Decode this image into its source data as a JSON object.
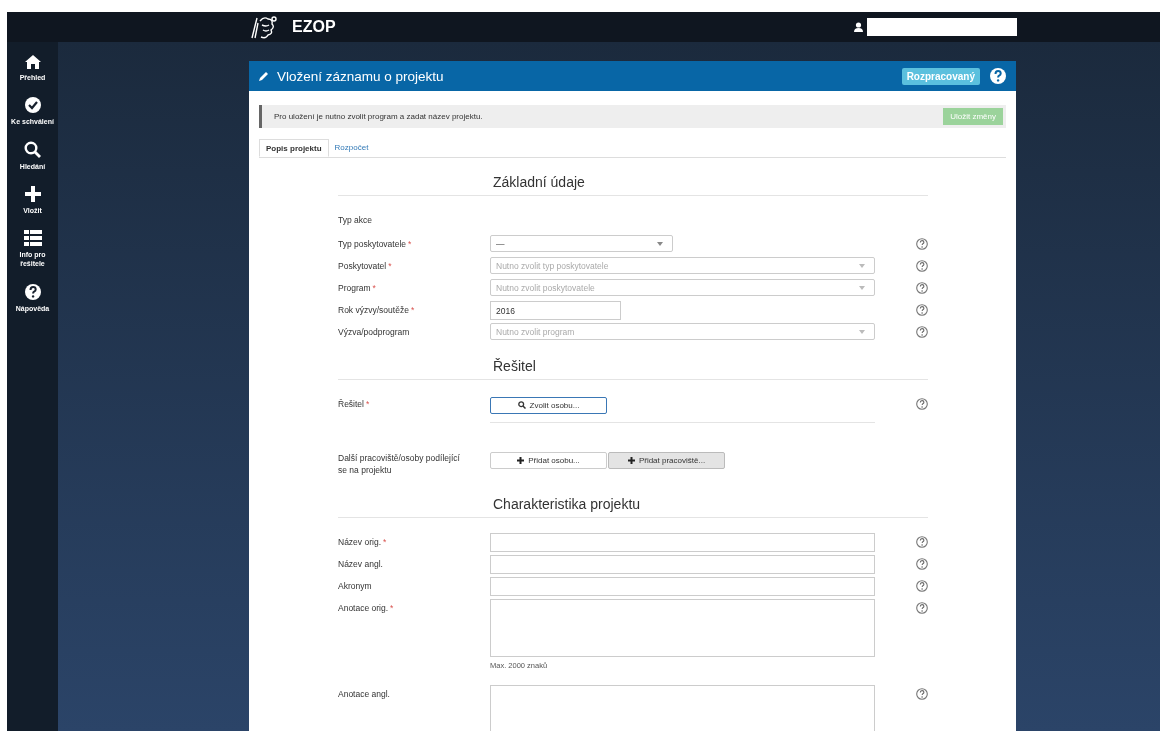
{
  "top_bar": {
    "app_name": "EZOP"
  },
  "sidebar": {
    "items": [
      {
        "label": "Přehled"
      },
      {
        "label": "Ke schválení"
      },
      {
        "label": "Hledání"
      },
      {
        "label": "Vložit"
      },
      {
        "label": "Info pro řešitele"
      },
      {
        "label": "Nápověda"
      }
    ]
  },
  "panel": {
    "title": "Vložení záznamu o projektu",
    "status": "Rozpracovaný",
    "alert": {
      "text": "Pro uložení je nutno zvolit program a zadat název projektu.",
      "save_button": {
        "label": "Uložit změny",
        "disabled": true
      }
    },
    "tabs": [
      {
        "label": "Popis projektu",
        "selected": true
      },
      {
        "label": "Rozpočet",
        "selected": false
      }
    ],
    "sections": [
      {
        "heading": "Základní údaje",
        "fields": [
          {
            "kind": "text",
            "label": "Typ akce"
          },
          {
            "kind": "select",
            "label": "Typ poskytovatele",
            "mark": "*",
            "value": "—",
            "disabled": false,
            "help": true
          },
          {
            "kind": "select",
            "label": "Poskytovatel",
            "mark": "*",
            "placeholder": "Nutno zvolit typ poskytovatele",
            "disabled": true,
            "help": true
          },
          {
            "kind": "select",
            "label": "Program",
            "mark": "*",
            "placeholder": "Nutno zvolit poskytovatele",
            "disabled": true,
            "help": true
          },
          {
            "kind": "input",
            "label": "Rok výzvy/soutěže",
            "mark": "*",
            "value": "2016",
            "help": true
          },
          {
            "kind": "select",
            "label": "Výzva/podprogram",
            "placeholder": "Nutno zvolit program",
            "disabled": true,
            "help": true
          }
        ]
      },
      {
        "heading": "Řešitel",
        "fields": [
          {
            "kind": "person",
            "label": "Řešitel",
            "mark": "*",
            "button": "Zvolit osobu...",
            "help": true
          },
          {
            "kind": "add",
            "label": "Další pracoviště/osoby podílející se na projektu",
            "buttons": [
              {
                "label": "Přidat osobu...",
                "active": false
              },
              {
                "label": "Přidat pracoviště...",
                "active": true
              }
            ]
          }
        ]
      },
      {
        "heading": "Charakteristika projektu",
        "fields": [
          {
            "kind": "wide",
            "label": "Název orig.",
            "mark": "*",
            "help": true
          },
          {
            "kind": "wide",
            "label": "Název angl.",
            "help": true
          },
          {
            "kind": "wide",
            "label": "Akronym",
            "help": true
          },
          {
            "kind": "textarea",
            "label": "Anotace orig.",
            "mark": "*",
            "note": "Max. 2000 znaků",
            "help": true
          },
          {
            "kind": "textarea",
            "label": "Anotace angl.",
            "help": true
          }
        ]
      }
    ]
  }
}
